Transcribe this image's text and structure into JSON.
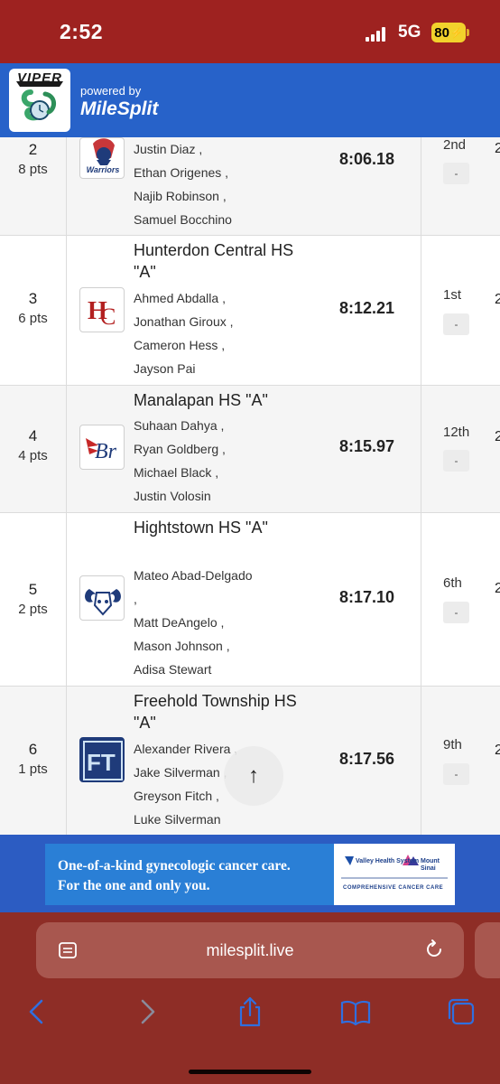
{
  "status_bar": {
    "time": "2:52",
    "network": "5G",
    "battery": "80"
  },
  "header": {
    "logo_text": "VIPER",
    "powered_by": "powered by",
    "brand": "MileSplit"
  },
  "results": [
    {
      "place": "2",
      "points": "8 pts",
      "team": "",
      "emblem_caption": "Warriors",
      "athletes": [
        "Justin Diaz ,",
        "Ethan Origenes ,",
        "Najib Robinson ,",
        "Samuel Bocchino"
      ],
      "mark": "8:06.18",
      "heat_place": "2nd",
      "dash": "-"
    },
    {
      "place": "3",
      "points": "6 pts",
      "team": "Hunterdon Central HS \"A\"",
      "emblem_caption": "HC",
      "athletes": [
        "Ahmed Abdalla ,",
        "Jonathan Giroux ,",
        "Cameron Hess ,",
        "Jayson Pai"
      ],
      "mark": "8:12.21",
      "heat_place": "1st",
      "dash": "-"
    },
    {
      "place": "4",
      "points": "4 pts",
      "team": "Manalapan HS \"A\"",
      "emblem_caption": "Br",
      "athletes": [
        "Suhaan Dahya ,",
        "Ryan Goldberg ,",
        "Michael Black ,",
        "Justin Volosin"
      ],
      "mark": "8:15.97",
      "heat_place": "12th",
      "dash": "-"
    },
    {
      "place": "5",
      "points": "2 pts",
      "team": "Hightstown HS \"A\"",
      "emblem_caption": "",
      "athletes": [
        "Mateo Abad-Delgado",
        ",",
        "Matt DeAngelo ,",
        "Mason Johnson ,",
        "Adisa Stewart"
      ],
      "mark": "8:17.10",
      "heat_place": "6th",
      "dash": "-"
    },
    {
      "place": "6",
      "points": "1 pts",
      "team": "Freehold Township HS \"A\"",
      "emblem_caption": "FT",
      "athletes": [
        "Alexander Rivera ,",
        "Jake Silverman ,",
        "Greyson Fitch ,",
        "Luke Silverman"
      ],
      "mark": "8:17.56",
      "heat_place": "9th",
      "dash": "-"
    }
  ],
  "edge_char": "2",
  "scroll_top": "↑",
  "ad": {
    "line1": "One-of-a-kind gynecologic cancer care.",
    "line2": "For the one and only you.",
    "logo1": "Valley Health System",
    "logo2": "Mount Sinai",
    "sub": "COMPREHENSIVE CANCER CARE"
  },
  "browser": {
    "url": "milesplit.live"
  },
  "colors": {
    "status_bar": "#9e2220",
    "header": "#2762c9",
    "browser_bar": "#8e2d26",
    "url_bar": "#a8574f",
    "ad_bg": "#2a7fd6",
    "nav_icon": "#2f6fe0",
    "nav_icon_disabled": "#8a8a9a"
  }
}
